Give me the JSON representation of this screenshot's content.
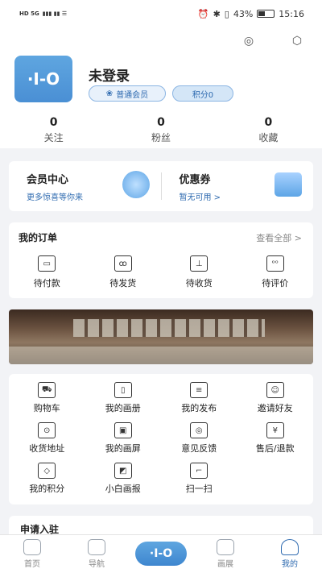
{
  "status_bar": {
    "left": "HD 5G",
    "battery": "43%",
    "time": "15:16"
  },
  "profile": {
    "username": "未登录",
    "member_badge": "普通会员",
    "points_badge": "积分0",
    "avatar_text": "·I-O"
  },
  "stats": [
    {
      "num": "0",
      "label": "关注"
    },
    {
      "num": "0",
      "label": "粉丝"
    },
    {
      "num": "0",
      "label": "收藏"
    }
  ],
  "member_center": {
    "title": "会员中心",
    "sub": "更多惊喜等你来"
  },
  "coupons": {
    "title": "优惠券",
    "sub": "暂无可用 >"
  },
  "orders": {
    "title": "我的订单",
    "view_all": "查看全部  >",
    "items": [
      {
        "label": "待付款",
        "icon": "wallet-icon"
      },
      {
        "label": "待发货",
        "icon": "box-icon"
      },
      {
        "label": "待收货",
        "icon": "receive-icon"
      },
      {
        "label": "待评价",
        "icon": "review-icon"
      }
    ]
  },
  "tools": [
    {
      "label": "购物车",
      "icon": "cart-icon"
    },
    {
      "label": "我的画册",
      "icon": "album-icon"
    },
    {
      "label": "我的发布",
      "icon": "publish-icon"
    },
    {
      "label": "邀请好友",
      "icon": "invite-icon"
    },
    {
      "label": "收货地址",
      "icon": "location-icon"
    },
    {
      "label": "我的画屏",
      "icon": "screen-icon"
    },
    {
      "label": "意见反馈",
      "icon": "feedback-icon"
    },
    {
      "label": "售后/退款",
      "icon": "refund-icon"
    },
    {
      "label": "我的积分",
      "icon": "points-icon"
    },
    {
      "label": "小白画报",
      "icon": "poster-icon"
    },
    {
      "label": "扫一扫",
      "icon": "scan-icon"
    }
  ],
  "apply_text": "申请入驻",
  "tabs": [
    {
      "label": "首页",
      "icon": "home-icon"
    },
    {
      "label": "导航",
      "icon": "grid-icon"
    },
    {
      "label": "",
      "icon": "center-logo-icon"
    },
    {
      "label": "画展",
      "icon": "exhibit-icon"
    },
    {
      "label": "我的",
      "icon": "profile-icon"
    }
  ],
  "colors": {
    "accent": "#2f6bb0",
    "brand_blue": "#4a8fd4",
    "background": "#f2f3f6"
  }
}
